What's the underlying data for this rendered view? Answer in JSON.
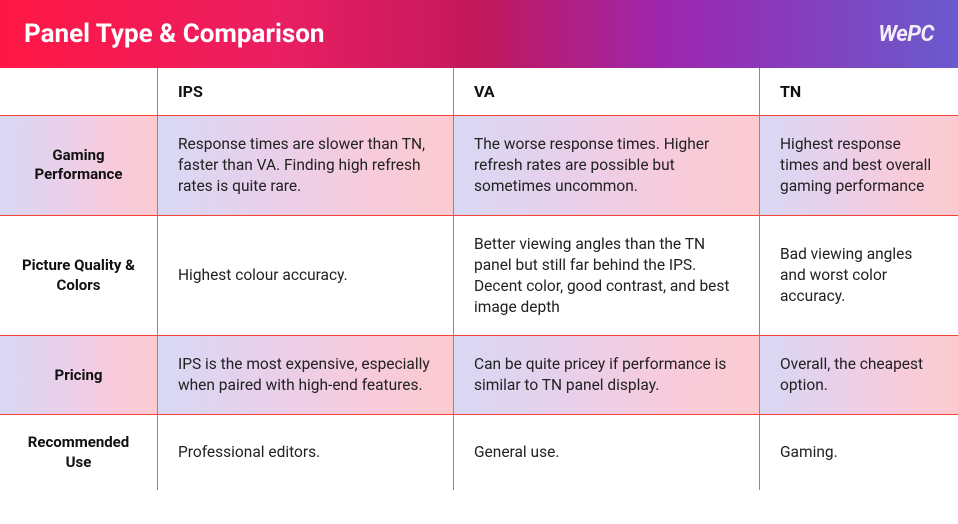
{
  "title": "Panel Type & Comparison",
  "logo": "WePC",
  "columns": [
    "IPS",
    "VA",
    "TN"
  ],
  "rows": [
    {
      "label": "Gaming Performance",
      "ips": "Response times are slower than TN, faster than VA. Finding high refresh rates is quite rare.",
      "va": "The worse response times. Higher refresh rates are possible but sometimes uncommon.",
      "tn": "Highest response times and best overall gaming performance"
    },
    {
      "label": "Picture Quality & Colors",
      "ips": "Highest colour accuracy.",
      "va": "Better viewing angles than the TN panel but still far behind the IPS. Decent color, good contrast, and best image depth",
      "tn": "Bad viewing angles and worst color accuracy."
    },
    {
      "label": "Pricing",
      "ips": "IPS is the most expensive, especially when paired with high-end features.",
      "va": "Can be quite pricey if performance is similar to TN panel display.",
      "tn": "Overall, the cheapest option."
    },
    {
      "label": "Recommended Use",
      "ips": "Professional editors.",
      "va": "General use.",
      "tn": "Gaming."
    }
  ]
}
